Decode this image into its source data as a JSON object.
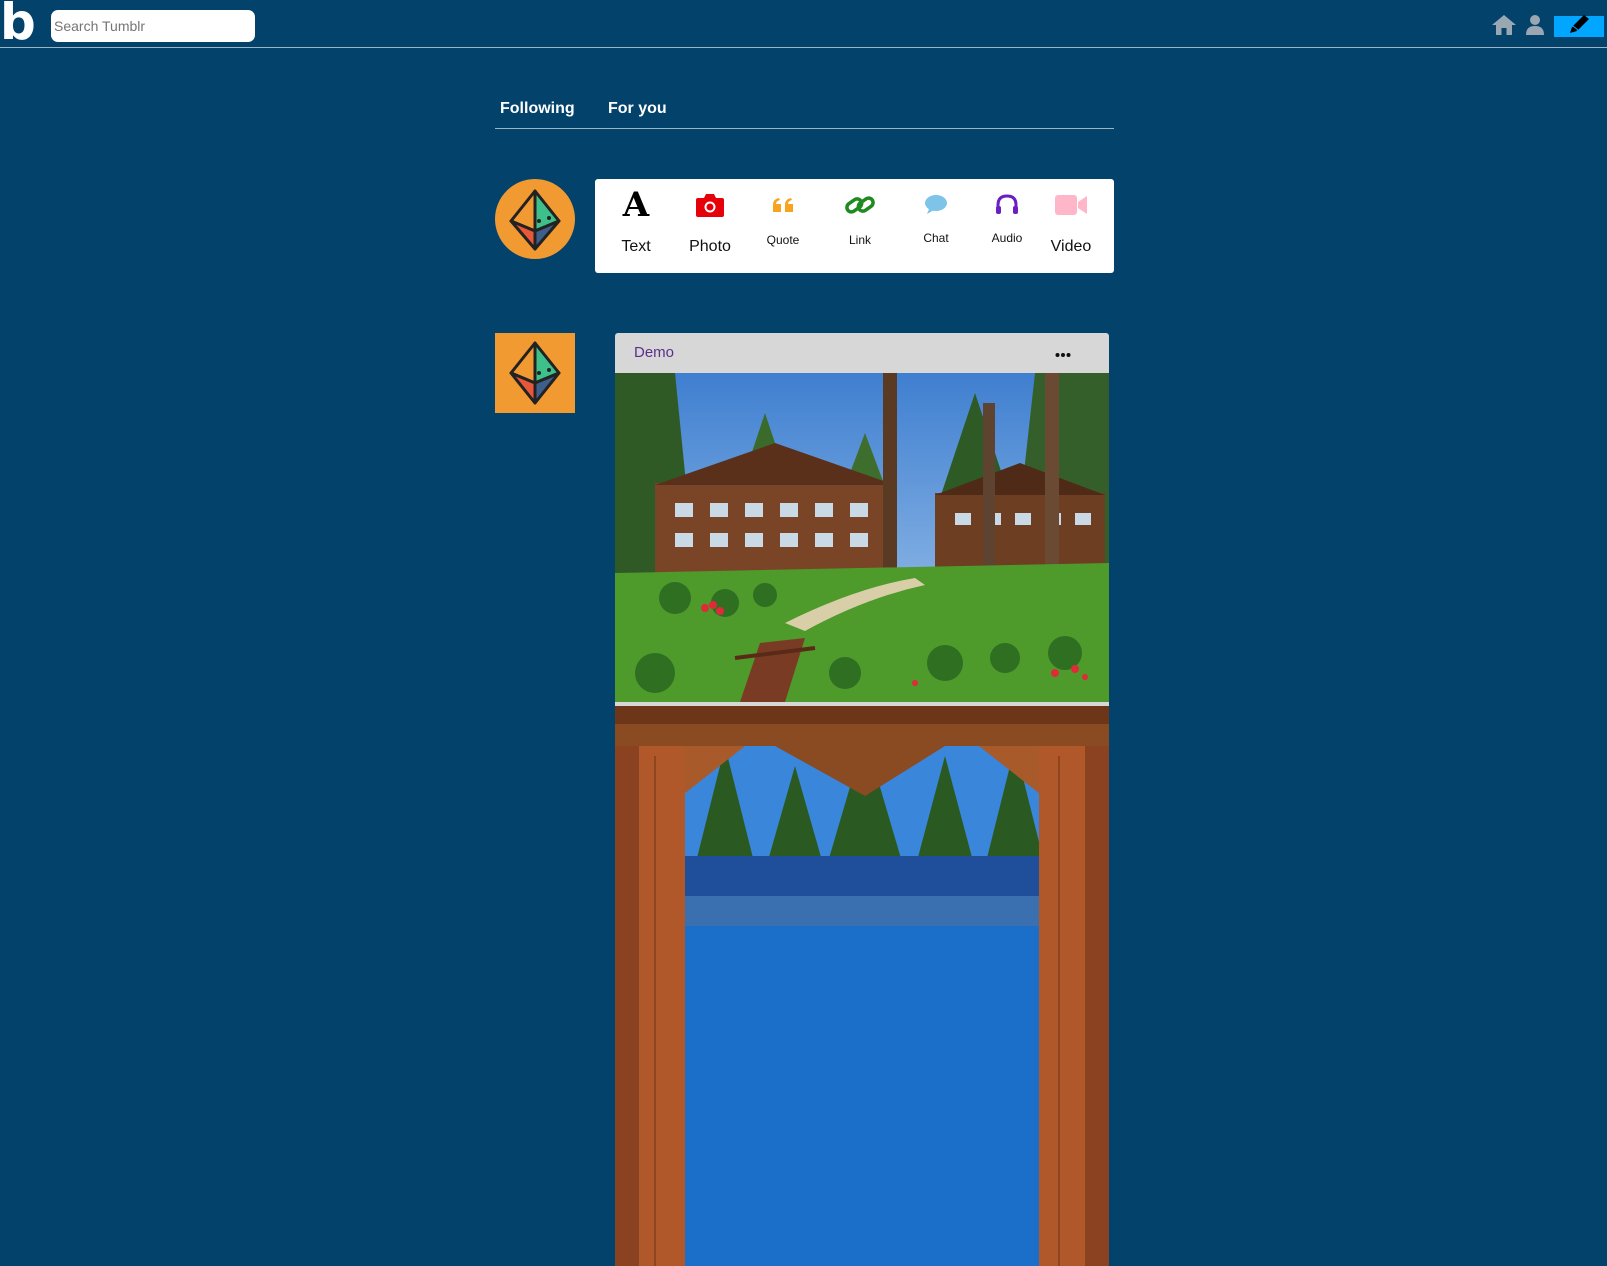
{
  "app": {
    "logo_text": "b"
  },
  "search": {
    "placeholder": "Search Tumblr"
  },
  "nav": {
    "icons": [
      "home-icon",
      "user-icon",
      "pencil-icon"
    ],
    "compose_color": "#00a6ff"
  },
  "tabs": [
    {
      "label": "Following"
    },
    {
      "label": "For you"
    }
  ],
  "post_types": [
    {
      "label": "Text",
      "icon": "text-icon",
      "color": "#000000"
    },
    {
      "label": "Photo",
      "icon": "camera-icon",
      "color": "#e5000a"
    },
    {
      "label": "Quote",
      "icon": "quote-icon",
      "color": "#f7a521"
    },
    {
      "label": "Link",
      "icon": "link-icon",
      "color": "#1f8a1f"
    },
    {
      "label": "Chat",
      "icon": "chat-bubble-icon",
      "color": "#7ec3e8"
    },
    {
      "label": "Audio",
      "icon": "headphones-icon",
      "color": "#6a1fc4"
    },
    {
      "label": "Video",
      "icon": "video-camera-icon",
      "color": "#ffb6c8"
    }
  ],
  "post": {
    "blog_name": "Demo",
    "menu_icon": "more-dots-icon",
    "photos": [
      {
        "description_icon": "lodge-photo"
      },
      {
        "description_icon": "lake-view-photo"
      }
    ]
  },
  "colors": {
    "background": "#03426b",
    "avatar": "#f29a32"
  }
}
